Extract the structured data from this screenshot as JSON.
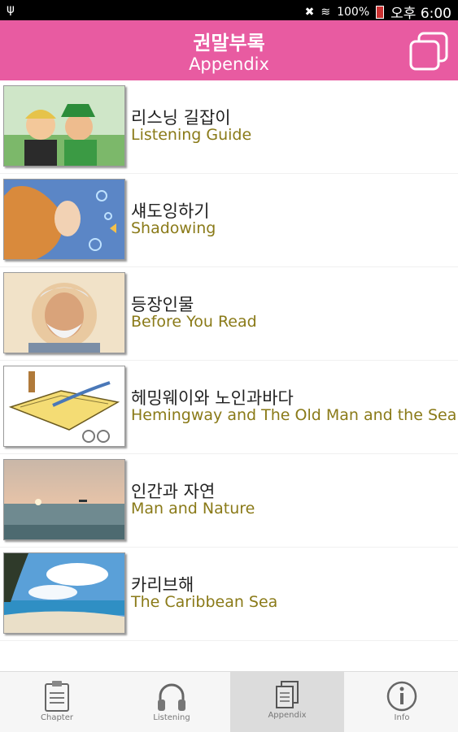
{
  "status_bar": {
    "battery": "100%",
    "time": "오후 6:00",
    "icons": [
      "usb-icon",
      "mute-icon",
      "wifi-icon",
      "battery-icon"
    ]
  },
  "header": {
    "title_ko": "권말부록",
    "title_en": "Appendix",
    "accent_color": "#e85ba1",
    "action_icon": "copy-icon"
  },
  "items": [
    {
      "ko": "리스닝 길잡이",
      "en": "Listening Guide",
      "thumb": "two-boys-illustration"
    },
    {
      "ko": "섀도잉하기",
      "en": "Shadowing",
      "thumb": "girl-underwater-illustration"
    },
    {
      "ko": "등장인물",
      "en": "Before You Read",
      "thumb": "old-man-portrait"
    },
    {
      "ko": "헤밍웨이와 노인과바다",
      "en": "Hemingway and The Old Man and the Sea",
      "thumb": "book-and-quill-illustration"
    },
    {
      "ko": "인간과 자연",
      "en": "Man and Nature",
      "thumb": "sunset-sea-photo"
    },
    {
      "ko": "카리브해",
      "en": "The Caribbean Sea",
      "thumb": "caribbean-beach-photo"
    }
  ],
  "tabs": [
    {
      "label": "Chapter",
      "icon": "clipboard-icon"
    },
    {
      "label": "Listening",
      "icon": "headphones-icon"
    },
    {
      "label": "Appendix",
      "icon": "documents-icon",
      "active": true
    },
    {
      "label": "Info",
      "icon": "info-icon"
    }
  ],
  "colors": {
    "english_text": "#8a7a18",
    "tab_active_bg": "#dcdcdc"
  }
}
